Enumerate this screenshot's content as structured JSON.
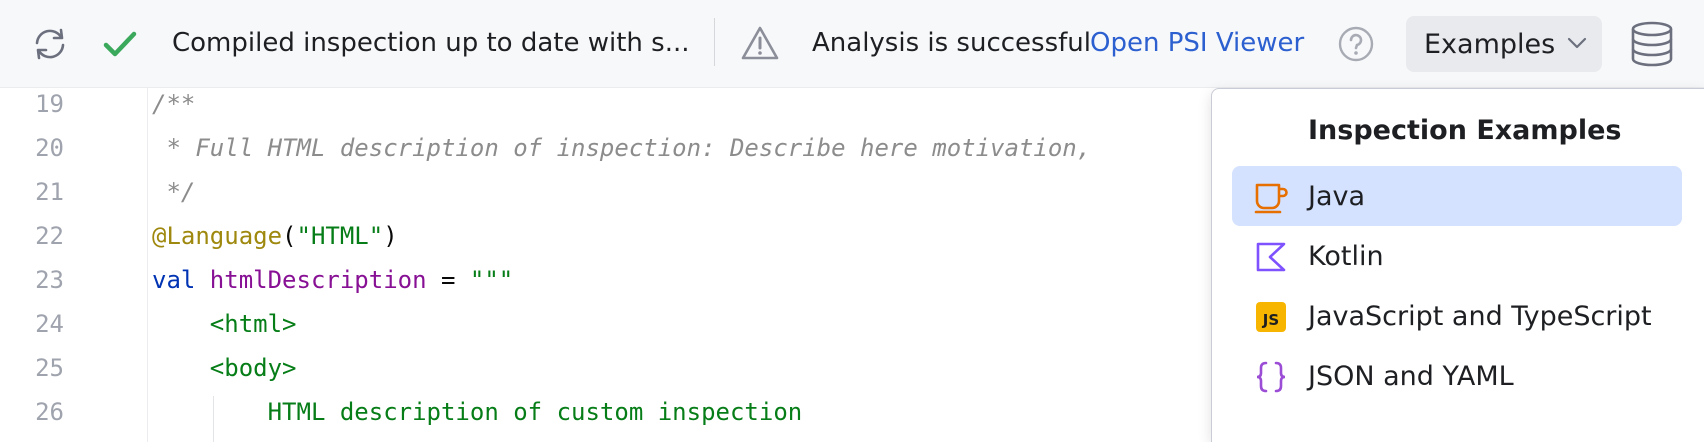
{
  "toolbar": {
    "sync_icon": "sync-icon",
    "check_icon": "check-icon",
    "compile_status": "Compiled inspection up to date with s...",
    "warning_icon": "warning-icon",
    "analysis_status": "Analysis is successful",
    "psi_link": "Open PSI Viewer",
    "help_icon": "help-icon",
    "examples_label": "Examples",
    "database_icon": "database-icon"
  },
  "editor": {
    "lines": [
      {
        "num": "19",
        "tokens": [
          {
            "t": "/**",
            "c": "c-comment"
          }
        ]
      },
      {
        "num": "20",
        "tokens": [
          {
            "t": " * Full HTML description of inspection: Describe here motivation, ",
            "c": "c-comment"
          }
        ]
      },
      {
        "num": "21",
        "tokens": [
          {
            "t": " */",
            "c": "c-comment"
          }
        ]
      },
      {
        "num": "22",
        "tokens": [
          {
            "t": "@Language",
            "c": "c-annot"
          },
          {
            "t": "(",
            "c": "c-plain"
          },
          {
            "t": "\"HTML\"",
            "c": "c-str"
          },
          {
            "t": ")",
            "c": "c-plain"
          }
        ]
      },
      {
        "num": "23",
        "tokens": [
          {
            "t": "val ",
            "c": "c-kw"
          },
          {
            "t": "htmlDescription",
            "c": "c-ident"
          },
          {
            "t": " = ",
            "c": "c-plain"
          },
          {
            "t": "\"\"\"",
            "c": "c-str"
          }
        ]
      },
      {
        "num": "24",
        "tokens": [
          {
            "t": "    <html>",
            "c": "c-str"
          }
        ]
      },
      {
        "num": "25",
        "tokens": [
          {
            "t": "    <body>",
            "c": "c-str"
          }
        ]
      },
      {
        "num": "26",
        "tokens": [
          {
            "t": "        HTML description of custom inspection",
            "c": "c-str"
          }
        ]
      }
    ]
  },
  "popup": {
    "title": "Inspection Examples",
    "items": [
      {
        "label": "Java",
        "icon": "java-cup-icon",
        "color": "#e76f00",
        "selected": true
      },
      {
        "label": "Kotlin",
        "icon": "kotlin-icon",
        "color": "#7f52ff",
        "selected": false
      },
      {
        "label": "JavaScript and TypeScript",
        "icon": "js-icon",
        "color": "#f7b500",
        "selected": false
      },
      {
        "label": "JSON and YAML",
        "icon": "json-braces-icon",
        "color": "#9b4dd6",
        "selected": false
      }
    ]
  },
  "colors": {
    "accent_link": "#2c5fcf",
    "check_green": "#3aa95b",
    "selection": "#d4e2ff"
  }
}
